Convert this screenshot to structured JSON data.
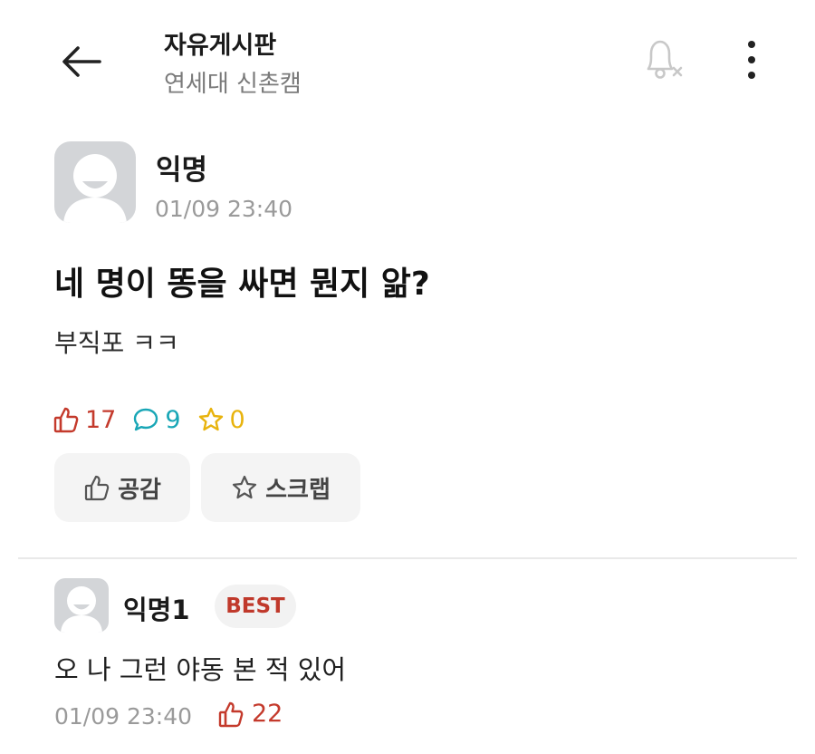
{
  "header": {
    "title": "자유게시판",
    "subtitle": "연세대 신촌캠",
    "icons": {
      "back": "arrow-left-icon",
      "notify": "bell-off-icon",
      "more": "more-vertical-icon"
    }
  },
  "post": {
    "author": "익명",
    "time": "01/09 23:40",
    "title": "네 명이 똥을 싸면 뭔지 앎?",
    "body": "부직포 ㅋㅋ",
    "stats": {
      "likes": "17",
      "comments": "9",
      "scraps": "0"
    },
    "actions": {
      "like_label": "공감",
      "scrap_label": "스크랩"
    }
  },
  "comments": [
    {
      "author": "익명1",
      "badge": "BEST",
      "text": "오 나 그런 야동 본 적 있어",
      "time": "01/09 23:40",
      "likes": "22"
    }
  ],
  "colors": {
    "like": "#c43a2c",
    "comment": "#18a6b6",
    "scrap": "#e8b30d",
    "muted": "#9a9a9a",
    "avatar_bg": "#d3d5d8"
  }
}
